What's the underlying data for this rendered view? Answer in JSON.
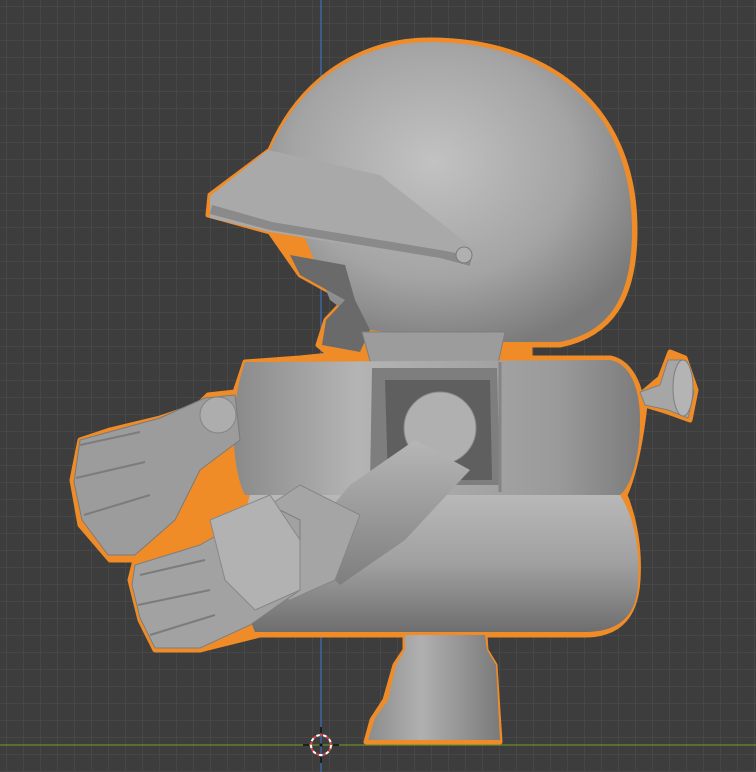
{
  "viewport": {
    "background": "#3d3d3d",
    "grid_color": "#474747",
    "x_axis_color": "#6c8c2a",
    "z_axis_color": "#3f6fb6",
    "selection_outline_color": "#f08c28"
  },
  "scene": {
    "object_shading_color": "#9a9a9a",
    "cursor_icon": "3d-cursor-icon"
  }
}
